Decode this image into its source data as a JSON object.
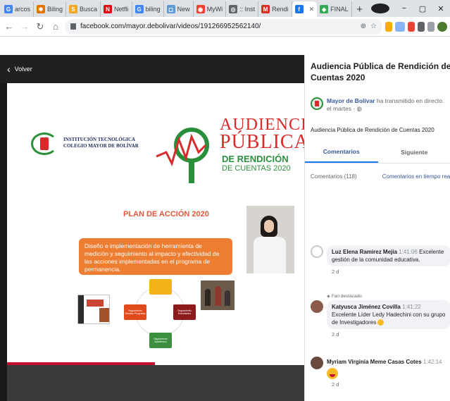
{
  "browser": {
    "tabs": [
      {
        "label": "arcos",
        "color": "#4285f4",
        "glyph": "G"
      },
      {
        "label": "Biling",
        "color": "#e37400",
        "glyph": "✱"
      },
      {
        "label": "Busca",
        "color": "#f5a623",
        "glyph": "S"
      },
      {
        "label": "Netfli",
        "color": "#e50914",
        "glyph": "N"
      },
      {
        "label": "biling",
        "color": "#4285f4",
        "glyph": "G"
      },
      {
        "label": "New",
        "color": "#5b9bd5",
        "glyph": "◻"
      },
      {
        "label": "MyWi",
        "color": "#ea4335",
        "glyph": "◉"
      },
      {
        "label": ":: Inst",
        "color": "#5f6368",
        "glyph": "◎"
      },
      {
        "label": "Rendi",
        "color": "#d93025",
        "glyph": "M"
      },
      {
        "label": "",
        "color": "#1877f2",
        "glyph": "f",
        "active": true
      },
      {
        "label": "FINAL",
        "color": "#34a853",
        "glyph": "◆"
      }
    ],
    "new_tab_symbol": "+",
    "window_controls": {
      "minimize": "−",
      "maximize": "▢",
      "close": "✕"
    },
    "url": "facebook.com/mayor.debolivar/videos/191266952562140/"
  },
  "video": {
    "back_label": "Volver",
    "slide": {
      "institution": "INSTITUCIÓN TECNOLÓGICA COLEGIO MAYOR DE BOLÍVAR",
      "audiencia_line1": "AUDIENCIA",
      "audiencia_line2": "PÚBLICA",
      "audiencia_line3": "DE RENDICIÓN",
      "audiencia_line4": "DE CUENTAS 2020",
      "plan_title": "PLAN DE ACCIÓN 2020",
      "objective": "Diseño e implementación de herramienta de medición y seguimiento al impacto y efectividad de las acciones implementadas en el programa de permanencia.",
      "nodes": {
        "left": "Seguimiento Efectivo Programa",
        "right": "Seguimiento Estudiantes",
        "bottom": "Seguimiento Académico"
      }
    }
  },
  "panel": {
    "video_title": "Audiencia Pública de Rendición de Cuentas 2020",
    "page_name": "Mayor de Bolívar",
    "page_action": " ha transmitido en directo.",
    "page_time": "el martes · ◍",
    "description": "Audiencia Pública de Rendición de Cuentas 2020",
    "tab_comments": "Comentarios",
    "tab_next": "Siguiente",
    "comments_count": "Comentarios (118)",
    "realtime_label": "Comentarios en tiempo real",
    "comments": [
      {
        "author": "Luz Elena Ramirez Mejia",
        "timestamp": "1:41:06",
        "text": "Excelente gestión de la comunidad educativa.",
        "age": "2 d",
        "badge": ""
      },
      {
        "author": "Katyusca Jiménez Covilla",
        "timestamp": "1:41:22",
        "text": "Excelente Líder Ledy Hadechini con su grupo de Investigadores",
        "age": "2 d",
        "badge": "Fan destacado"
      },
      {
        "author": "Myriam Virginia Meme Casas Cotes",
        "timestamp": "1:42:14",
        "text": "",
        "age": "2 d",
        "badge": ""
      }
    ]
  },
  "colors": {
    "facebook_blue": "#1877f2",
    "link_blue": "#385898",
    "slide_red": "#d82a2a",
    "slide_green": "#2a8f3a",
    "slide_orange": "#ed7d31"
  }
}
